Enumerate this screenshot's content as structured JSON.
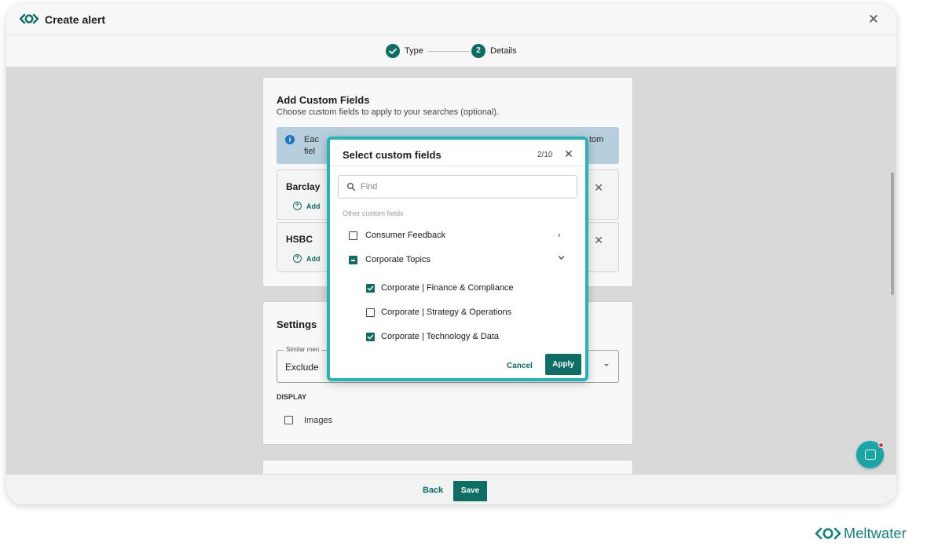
{
  "window": {
    "title": "Create alert"
  },
  "stepper": {
    "steps": [
      {
        "label": "Type",
        "state": "done"
      },
      {
        "label": "Details",
        "number": "2",
        "state": "active"
      }
    ]
  },
  "custom_fields_card": {
    "title": "Add Custom Fields",
    "subtitle": "Choose custom fields to apply to your searches (optional).",
    "info": {
      "line1": "Eac",
      "line2": "fiel",
      "tail": "tom"
    },
    "searches": [
      {
        "name": "Barclay",
        "add_label": "Add"
      },
      {
        "name": "HSBC",
        "add_label": "Add"
      }
    ]
  },
  "settings_card": {
    "title": "Settings",
    "select": {
      "legend": "Similar men",
      "value": "Exclude"
    },
    "display_label": "DISPLAY",
    "images_label": "Images"
  },
  "footer": {
    "back_label": "Back",
    "save_label": "Save"
  },
  "modal": {
    "title": "Select custom fields",
    "count": "2/10",
    "search_placeholder": "Find",
    "section_label": "Other custom fields",
    "groups": [
      {
        "label": "Consumer Feedback",
        "state": "unchecked",
        "expanded": false
      },
      {
        "label": "Corporate Topics",
        "state": "indeterminate",
        "expanded": true
      }
    ],
    "options": [
      {
        "label": "Corporate | Finance & Compliance",
        "checked": true
      },
      {
        "label": "Corporate | Strategy & Operations",
        "checked": false
      },
      {
        "label": "Corporate | Technology & Data",
        "checked": true
      }
    ],
    "cancel_label": "Cancel",
    "apply_label": "Apply"
  },
  "brand": {
    "name": "Meltwater",
    "color": "#0e8179"
  },
  "colors": {
    "accent": "#0e6e64",
    "modal_border": "#27b2b5",
    "info_bg": "#b7cfdc",
    "chat": "#1aa6a6"
  }
}
